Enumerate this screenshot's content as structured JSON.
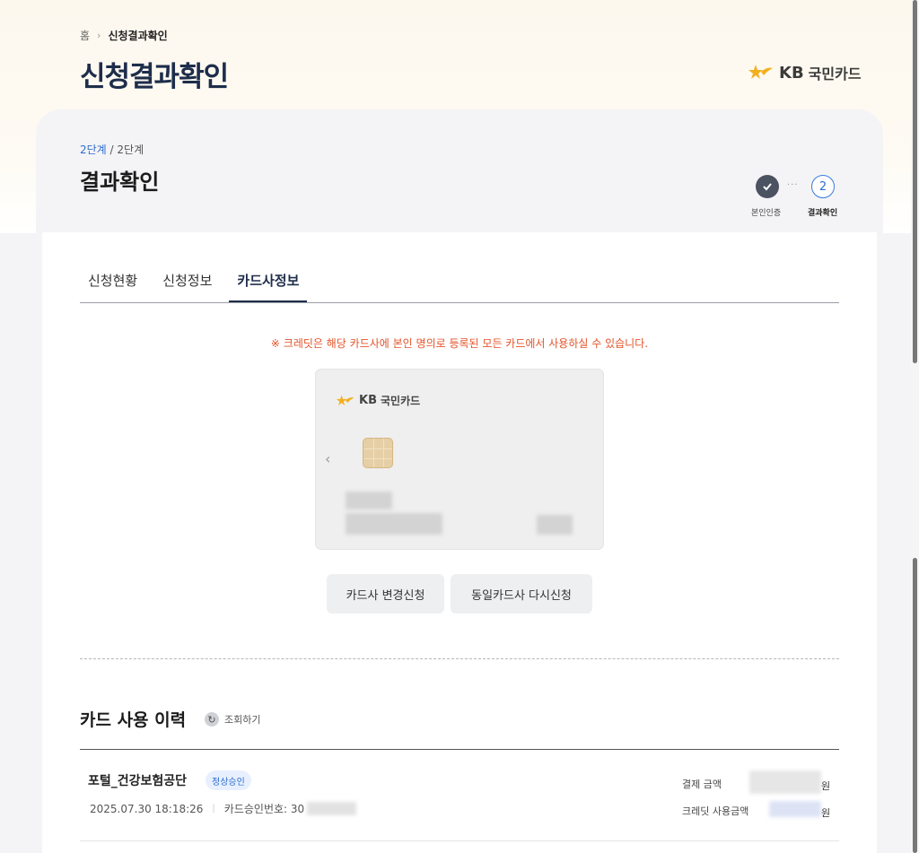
{
  "breadcrumb": {
    "home": "홈",
    "separator": "›",
    "current": "신청결과확인"
  },
  "page": {
    "title": "신청결과확인"
  },
  "brand": {
    "kb": "KB",
    "name": "국민카드",
    "accent_color": "#f2b01e"
  },
  "step": {
    "current": "2단계",
    "divider": " / ",
    "total": "2단계",
    "section_title": "결과확인",
    "steps": [
      {
        "label": "본인인증",
        "status": "done",
        "icon": "check-icon"
      },
      {
        "number": "2",
        "label": "결과확인",
        "status": "current"
      }
    ],
    "between": "···"
  },
  "tabs": [
    {
      "label": "신청현황",
      "active": false
    },
    {
      "label": "신청정보",
      "active": false
    },
    {
      "label": "카드사정보",
      "active": true
    }
  ],
  "notice": "※ 크레딧은 해당 카드사에 본인 명의로 등록된 모든 카드에서 사용하실 수 있습니다.",
  "card": {
    "brand_kb": "KB",
    "brand_name": "국민카드",
    "prev_icon": "chevron-left-icon"
  },
  "buttons": {
    "change": "카드사 변경신청",
    "reapply": "동일카드사 다시신청"
  },
  "history": {
    "title": "카드 사용 이력",
    "refresh_label": "조회하기",
    "rows": [
      {
        "merchant": "포털_건강보험공단",
        "badge": "정상승인",
        "datetime": "2025.07.30 18:18:26",
        "divider": "|",
        "approval_label": "카드승인번호: 30",
        "amount_label": "결제 금액",
        "credit_label": "크레딧 사용금액",
        "currency": "원"
      }
    ]
  },
  "colors": {
    "title": "#1e2d4b",
    "accent_blue": "#2e6cd1",
    "notice": "#e3542a"
  }
}
